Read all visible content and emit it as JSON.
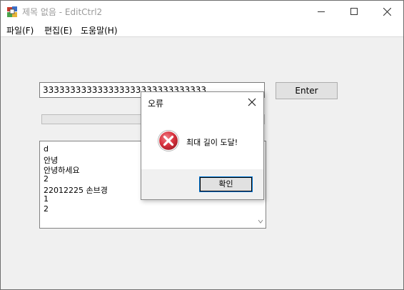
{
  "window": {
    "title": "제목 없음 - EditCtrl2",
    "icons": {
      "app": "mfc-app-icon",
      "minimize": "minimize-icon",
      "maximize": "maximize-icon",
      "close": "close-icon"
    }
  },
  "menubar": {
    "items": [
      {
        "label": "파일(F)"
      },
      {
        "label": "편집(E)"
      },
      {
        "label": "도움말(H)"
      }
    ]
  },
  "main": {
    "edit_value": "333333333333333333333333333333",
    "enter_label": "Enter",
    "progress_value": 0,
    "list_lines": [
      "d",
      "안녕",
      "안녕하세요",
      "2",
      "22012225 손브경",
      "1",
      "2"
    ]
  },
  "dialog": {
    "title": "오류",
    "message": "최대 길이 도달!",
    "ok_label": "확인",
    "icon": "error-icon",
    "colors": {
      "error": "#d9333f"
    }
  }
}
